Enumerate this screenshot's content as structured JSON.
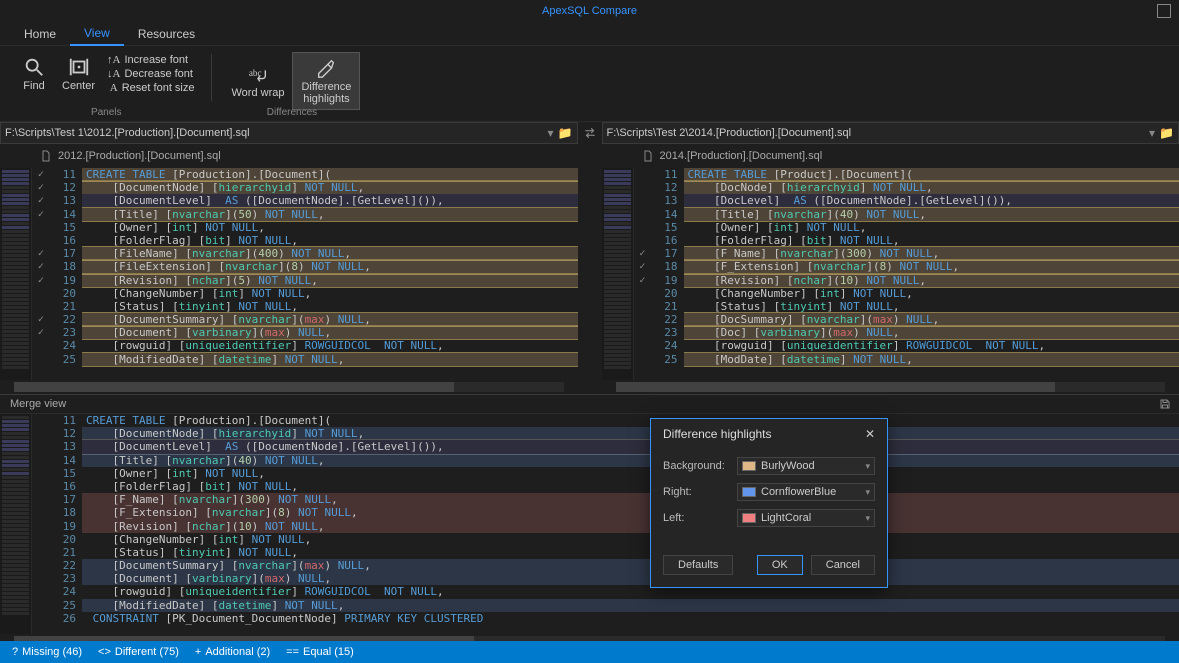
{
  "titlebar": {
    "title": "ApexSQL Compare"
  },
  "tabs": {
    "home": "Home",
    "view": "View",
    "resources": "Resources"
  },
  "ribbon": {
    "find": "Find",
    "center": "Center",
    "increase_font": "Increase font",
    "decrease_font": "Decrease font",
    "reset_font": "Reset font size",
    "word_wrap": "Word wrap",
    "diff_highlights": "Difference\nhighlights",
    "group_panels": "Panels",
    "group_differences": "Differences"
  },
  "paths": {
    "left": "F:\\Scripts\\Test 1\\2012.[Production].[Document].sql",
    "right": "F:\\Scripts\\Test 2\\2014.[Production].[Document].sql"
  },
  "filelabels": {
    "left": "2012.[Production].[Document].sql",
    "right": "2014.[Production].[Document].sql"
  },
  "left_lines": [
    {
      "n": 11,
      "hl": "diff",
      "chk": true,
      "t": "CREATE TABLE [Production].[Document]("
    },
    {
      "n": 12,
      "hl": "diff",
      "chk": true,
      "t": "    [DocumentNode] [hierarchyid] NOT NULL,"
    },
    {
      "n": 13,
      "hl": "sel",
      "chk": true,
      "t": "    [DocumentLevel]  AS ([DocumentNode].[GetLevel]()),"
    },
    {
      "n": 14,
      "hl": "diff",
      "chk": true,
      "t": "    [Title] [nvarchar](50) NOT NULL,"
    },
    {
      "n": 15,
      "t": "    [Owner] [int] NOT NULL,"
    },
    {
      "n": 16,
      "t": "    [FolderFlag] [bit] NOT NULL,"
    },
    {
      "n": 17,
      "hl": "diff",
      "chk": true,
      "t": "    [FileName] [nvarchar](400) NOT NULL,"
    },
    {
      "n": 18,
      "hl": "diff",
      "chk": true,
      "t": "    [FileExtension] [nvarchar](8) NOT NULL,"
    },
    {
      "n": 19,
      "hl": "diff",
      "chk": true,
      "t": "    [Revision] [nchar](5) NOT NULL,"
    },
    {
      "n": 20,
      "t": "    [ChangeNumber] [int] NOT NULL,"
    },
    {
      "n": 21,
      "t": "    [Status] [tinyint] NOT NULL,"
    },
    {
      "n": 22,
      "hl": "diff",
      "chk": true,
      "t": "    [DocumentSummary] [nvarchar](max) NULL,"
    },
    {
      "n": 23,
      "hl": "diff",
      "chk": true,
      "t": "    [Document] [varbinary](max) NULL,"
    },
    {
      "n": 24,
      "t": "    [rowguid] [uniqueidentifier] ROWGUIDCOL  NOT NULL,"
    },
    {
      "n": 25,
      "hl": "diff",
      "t": "    [ModifiedDate] [datetime] NOT NULL,"
    }
  ],
  "right_lines": [
    {
      "n": 11,
      "hl": "diff",
      "t": "CREATE TABLE [Product].[Document]("
    },
    {
      "n": 12,
      "hl": "diff",
      "t": "    [DocNode] [hierarchyid] NOT NULL,"
    },
    {
      "n": 13,
      "hl": "sel",
      "t": "    [DocLevel]  AS ([DocumentNode].[GetLevel]()),"
    },
    {
      "n": 14,
      "hl": "diff",
      "t": "    [Title] [nvarchar](40) NOT NULL,"
    },
    {
      "n": 15,
      "t": "    [Owner] [int] NOT NULL,"
    },
    {
      "n": 16,
      "t": "    [FolderFlag] [bit] NOT NULL,"
    },
    {
      "n": 17,
      "hl": "diff",
      "chk": true,
      "t": "    [F_Name] [nvarchar](300) NOT NULL,"
    },
    {
      "n": 18,
      "hl": "diff",
      "chk": true,
      "t": "    [F_Extension] [nvarchar](8) NOT NULL,"
    },
    {
      "n": 19,
      "hl": "diff",
      "chk": true,
      "t": "    [Revision] [nchar](10) NOT NULL,"
    },
    {
      "n": 20,
      "t": "    [ChangeNumber] [int] NOT NULL,"
    },
    {
      "n": 21,
      "t": "    [Status] [tinyint] NOT NULL,"
    },
    {
      "n": 22,
      "hl": "diff",
      "t": "    [DocSummary] [nvarchar](max) NULL,"
    },
    {
      "n": 23,
      "hl": "diff",
      "t": "    [Doc] [varbinary](max) NULL,"
    },
    {
      "n": 24,
      "t": "    [rowguid] [uniqueidentifier] ROWGUIDCOL  NOT NULL,"
    },
    {
      "n": 25,
      "hl": "diff",
      "t": "    [ModDate] [datetime] NOT NULL,"
    }
  ],
  "merge_header": "Merge view",
  "merge_lines": [
    {
      "n": 11,
      "t": "CREATE TABLE [Production].[Document]("
    },
    {
      "n": 12,
      "hl": "right",
      "t": "    [DocumentNode] [hierarchyid] NOT NULL,"
    },
    {
      "n": 13,
      "hl": "sel2",
      "t": "    [DocumentLevel]  AS ([DocumentNode].[GetLevel]()),"
    },
    {
      "n": 14,
      "hl": "right",
      "t": "    [Title] [nvarchar](40) NOT NULL,"
    },
    {
      "n": 15,
      "t": "    [Owner] [int] NOT NULL,"
    },
    {
      "n": 16,
      "t": "    [FolderFlag] [bit] NOT NULL,"
    },
    {
      "n": 17,
      "hl": "left",
      "t": "    [F_Name] [nvarchar](300) NOT NULL,"
    },
    {
      "n": 18,
      "hl": "left",
      "t": "    [F_Extension] [nvarchar](8) NOT NULL,"
    },
    {
      "n": 19,
      "hl": "left",
      "t": "    [Revision] [nchar](10) NOT NULL,"
    },
    {
      "n": 20,
      "t": "    [ChangeNumber] [int] NOT NULL,"
    },
    {
      "n": 21,
      "t": "    [Status] [tinyint] NOT NULL,"
    },
    {
      "n": 22,
      "hl": "right",
      "t": "    [DocumentSummary] [nvarchar](max) NULL,"
    },
    {
      "n": 23,
      "hl": "right",
      "t": "    [Document] [varbinary](max) NULL,"
    },
    {
      "n": 24,
      "t": "    [rowguid] [uniqueidentifier] ROWGUIDCOL  NOT NULL,"
    },
    {
      "n": 25,
      "hl": "right",
      "t": "    [ModifiedDate] [datetime] NOT NULL,"
    },
    {
      "n": 26,
      "t": " CONSTRAINT [PK_Document_DocumentNode] PRIMARY KEY CLUSTERED"
    }
  ],
  "dialog": {
    "title": "Difference highlights",
    "labels": {
      "background": "Background:",
      "right": "Right:",
      "left": "Left:"
    },
    "values": {
      "background": "BurlyWood",
      "right": "CornflowerBlue",
      "left": "LightCoral"
    },
    "colors": {
      "background": "#deb887",
      "right": "#6495ed",
      "left": "#f08080"
    },
    "buttons": {
      "defaults": "Defaults",
      "ok": "OK",
      "cancel": "Cancel"
    }
  },
  "statusbar": {
    "missing": "Missing (46)",
    "different": "Different (75)",
    "additional": "Additional (2)",
    "equal": "Equal (15)"
  }
}
